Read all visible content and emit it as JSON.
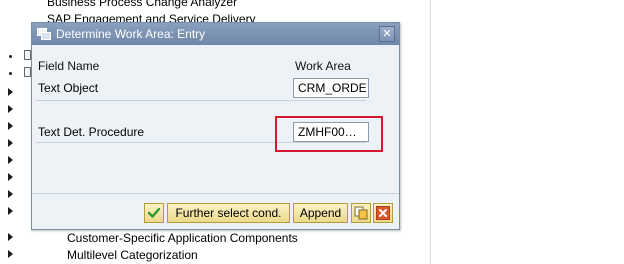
{
  "background": {
    "tree_items": [
      "Business Process Change Analyzer",
      "SAP Engagement and Service Delivery",
      "Customer-Specific Application Components",
      "Multilevel Categorization"
    ]
  },
  "dialog": {
    "title": "Determine Work Area: Entry",
    "close_symbol": "✕",
    "columns": {
      "field_name": "Field Name",
      "work_area": "Work Area"
    },
    "rows": [
      {
        "label": "Text Object",
        "value": "CRM_ORDE…"
      },
      {
        "label": "Text Det. Procedure",
        "value": "ZMHF00…"
      }
    ],
    "buttons": {
      "further_select": "Further select cond.",
      "append": "Append"
    },
    "colors": {
      "highlight": "#d7172f",
      "titlebar": "#7a90b2",
      "button_face": "#f4e6a8"
    },
    "icons": [
      "determine-icon",
      "close-icon",
      "confirm-check-icon",
      "copy-icon",
      "cancel-icon"
    ]
  }
}
